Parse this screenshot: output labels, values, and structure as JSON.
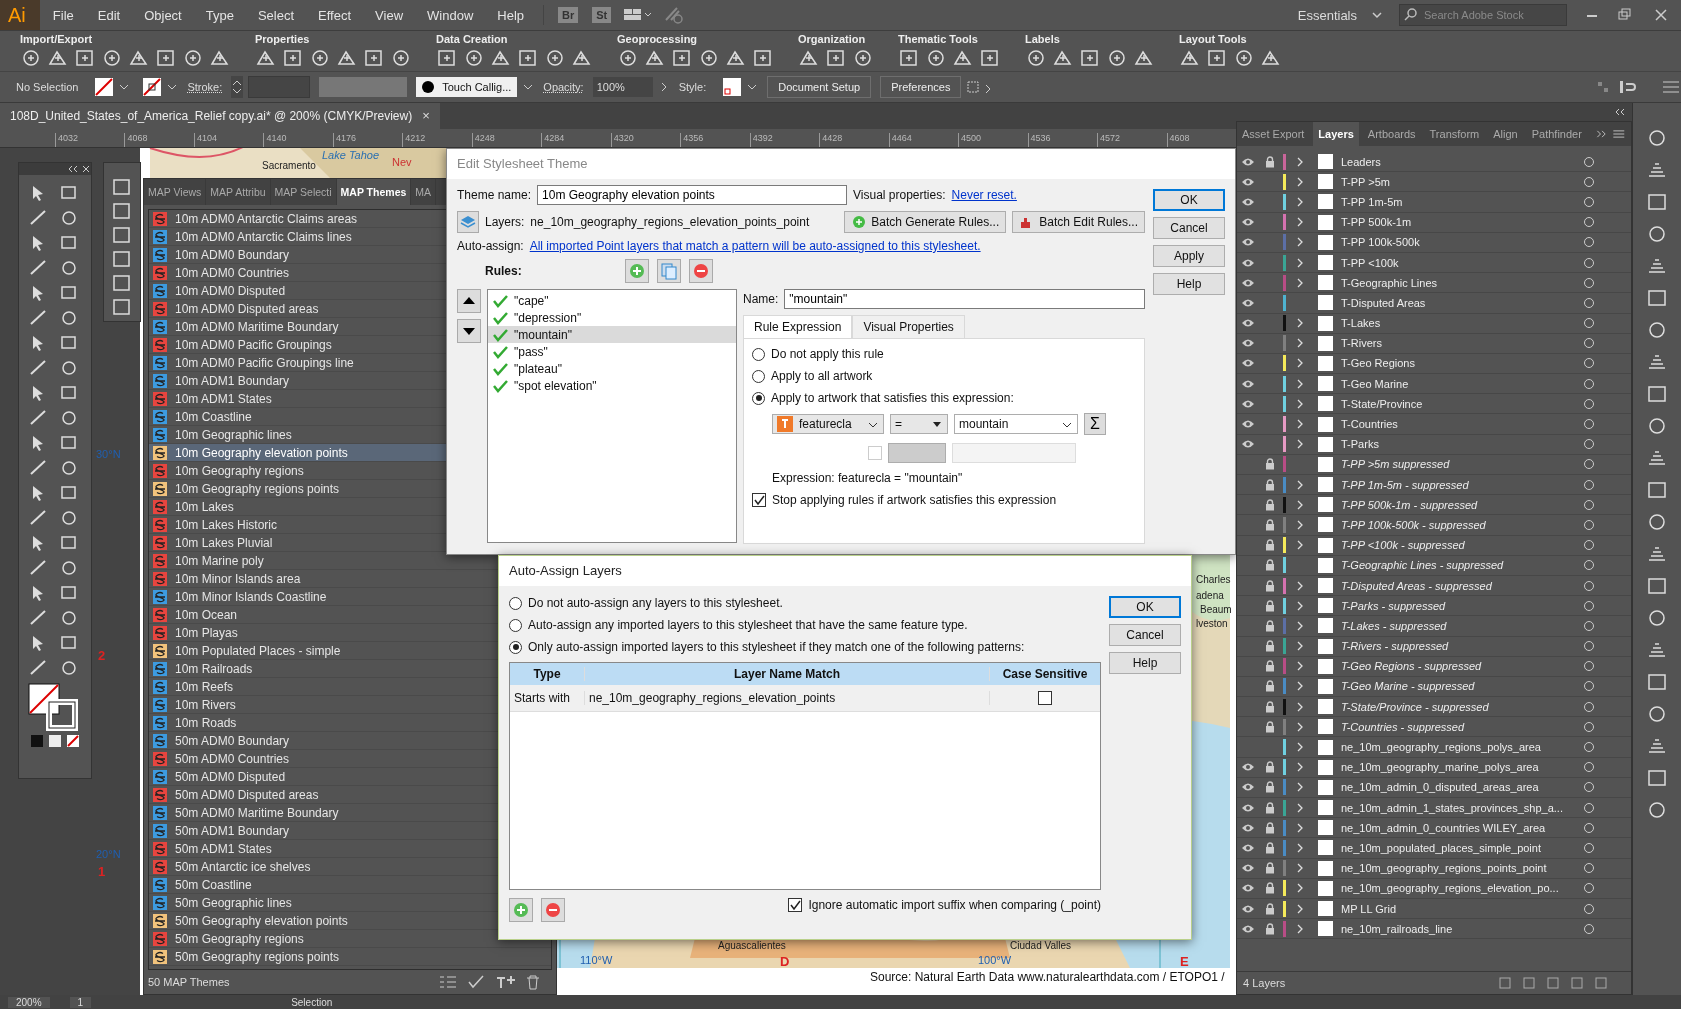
{
  "app": {
    "logo": "Ai",
    "menu": [
      "File",
      "Edit",
      "Object",
      "Type",
      "Select",
      "Effect",
      "View",
      "Window",
      "Help"
    ],
    "bridge": "Br",
    "stock": "St",
    "workspace": "Essentials",
    "search": {
      "placeholder": "Search Adobe Stock"
    }
  },
  "toolbar_groups": [
    {
      "label": "Import/Export"
    },
    {
      "label": "Properties"
    },
    {
      "label": "Data Creation"
    },
    {
      "label": "Geoprocessing"
    },
    {
      "label": "Organization"
    },
    {
      "label": "Thematic Tools"
    },
    {
      "label": "Labels"
    },
    {
      "label": "Layout Tools"
    }
  ],
  "control_bar": {
    "selection": "No Selection",
    "stroke_label": "Stroke:",
    "brush": "Touch Callig...",
    "opacity_label": "Opacity:",
    "opacity": "100%",
    "style_label": "Style:",
    "buttons": [
      "Document Setup",
      "Preferences"
    ]
  },
  "document_tab": {
    "title": "108D_United_States_of_America_Relief copy.ai* @ 200% (CMYK/Preview)",
    "close": "×"
  },
  "ruler": [
    "4032",
    "4068",
    "4104",
    "4140",
    "4176",
    "4212",
    "4248",
    "4284",
    "4320",
    "4356",
    "4392",
    "4428",
    "4464",
    "4500",
    "4536",
    "4572",
    "4608"
  ],
  "map_labels": [
    {
      "text": "Sacramento",
      "kind": "city"
    },
    {
      "text": "Lake Tahoe",
      "kind": "water"
    },
    {
      "text": "Nev",
      "kind": "state"
    },
    {
      "text": "30°N",
      "kind": "grid"
    },
    {
      "text": "2",
      "kind": "index"
    },
    {
      "text": "20°N",
      "kind": "grid"
    },
    {
      "text": "1",
      "kind": "index"
    },
    {
      "text": "Charles",
      "kind": "city"
    },
    {
      "text": "adena",
      "kind": "city"
    },
    {
      "text": "Beaum",
      "kind": "city"
    },
    {
      "text": "lveston",
      "kind": "city"
    },
    {
      "text": "Aguascalientes",
      "kind": "city"
    },
    {
      "text": "Ciudad Valles",
      "kind": "city"
    },
    {
      "text": "110°W",
      "kind": "grid"
    },
    {
      "text": "D",
      "kind": "index"
    },
    {
      "text": "100°W",
      "kind": "grid"
    },
    {
      "text": "E",
      "kind": "index"
    },
    {
      "text": "Source: Natural Earth Data www.naturalearthdata.com / ETOPO1 /",
      "kind": "credit"
    }
  ],
  "themes_panel": {
    "tabs": [
      {
        "label": "MAP Views",
        "selected": false
      },
      {
        "label": "MAP Attribu",
        "selected": false
      },
      {
        "label": "MAP Selecti",
        "selected": false
      },
      {
        "label": "MAP Themes",
        "selected": true
      },
      {
        "label": "MA",
        "selected": false
      }
    ],
    "items": [
      {
        "name": "10m ADM0 Antarctic Claims areas",
        "color": "#e8453f",
        "selected": false
      },
      {
        "name": "10m ADM0 Antarctic Claims lines",
        "color": "#3d9be0",
        "selected": false
      },
      {
        "name": "10m ADM0 Boundary",
        "color": "#3d9be0",
        "selected": false
      },
      {
        "name": "10m ADM0 Countries",
        "color": "#e8453f",
        "selected": false
      },
      {
        "name": "10m ADM0 Disputed",
        "color": "#3d9be0",
        "selected": false
      },
      {
        "name": "10m ADM0 Disputed areas",
        "color": "#e8453f",
        "selected": false
      },
      {
        "name": "10m ADM0 Maritime Boundary",
        "color": "#3d9be0",
        "selected": false
      },
      {
        "name": "10m ADM0 Pacific Groupings",
        "color": "#e8453f",
        "selected": false
      },
      {
        "name": "10m ADM0 Pacific Groupings line",
        "color": "#3d9be0",
        "selected": false
      },
      {
        "name": "10m ADM1 Boundary",
        "color": "#3d9be0",
        "selected": false
      },
      {
        "name": "10m ADM1 States",
        "color": "#e8453f",
        "selected": false
      },
      {
        "name": "10m Coastline",
        "color": "#3d9be0",
        "selected": false
      },
      {
        "name": "10m Geographic lines",
        "color": "#3d9be0",
        "selected": false
      },
      {
        "name": "10m Geography elevation points",
        "color": "#f2c37c",
        "selected": true
      },
      {
        "name": "10m Geography regions",
        "color": "#e8453f",
        "selected": false
      },
      {
        "name": "10m Geography regions points",
        "color": "#f2c37c",
        "selected": false
      },
      {
        "name": "10m Lakes",
        "color": "#e8453f",
        "selected": false
      },
      {
        "name": "10m Lakes Historic",
        "color": "#e8453f",
        "selected": false
      },
      {
        "name": "10m Lakes Pluvial",
        "color": "#e8453f",
        "selected": false
      },
      {
        "name": "10m Marine poly",
        "color": "#e8453f",
        "selected": false
      },
      {
        "name": "10m Minor Islands area",
        "color": "#e8453f",
        "selected": false
      },
      {
        "name": "10m Minor Islands Coastline",
        "color": "#3d9be0",
        "selected": false
      },
      {
        "name": "10m Ocean",
        "color": "#e8453f",
        "selected": false
      },
      {
        "name": "10m Playas",
        "color": "#e8453f",
        "selected": false
      },
      {
        "name": "10m Populated Places - simple",
        "color": "#f2c37c",
        "selected": false
      },
      {
        "name": "10m Railroads",
        "color": "#3d9be0",
        "selected": false
      },
      {
        "name": "10m Reefs",
        "color": "#3d9be0",
        "selected": false
      },
      {
        "name": "10m Rivers",
        "color": "#3d9be0",
        "selected": false
      },
      {
        "name": "10m Roads",
        "color": "#3d9be0",
        "selected": false
      },
      {
        "name": "50m ADM0 Boundary",
        "color": "#3d9be0",
        "selected": false
      },
      {
        "name": "50m ADM0 Countries",
        "color": "#e8453f",
        "selected": false
      },
      {
        "name": "50m ADM0 Disputed",
        "color": "#3d9be0",
        "selected": false
      },
      {
        "name": "50m ADM0 Disputed areas",
        "color": "#e8453f",
        "selected": false
      },
      {
        "name": "50m ADM0 Maritime Boundary",
        "color": "#3d9be0",
        "selected": false
      },
      {
        "name": "50m ADM1 Boundary",
        "color": "#3d9be0",
        "selected": false
      },
      {
        "name": "50m ADM1 States",
        "color": "#e8453f",
        "selected": false
      },
      {
        "name": "50m Antarctic ice shelves",
        "color": "#e8453f",
        "selected": false
      },
      {
        "name": "50m Coastline",
        "color": "#3d9be0",
        "selected": false
      },
      {
        "name": "50m Geographic lines",
        "color": "#3d9be0",
        "selected": false
      },
      {
        "name": "50m Geography elevation points",
        "color": "#f2c37c",
        "selected": false
      },
      {
        "name": "50m Geography regions",
        "color": "#e8453f",
        "selected": false
      },
      {
        "name": "50m Geography regions points",
        "color": "#f2c37c",
        "selected": false
      }
    ],
    "footer": "50 MAP Themes"
  },
  "stylesheet_dialog": {
    "title": "Edit Stylesheet Theme",
    "theme_name_label": "Theme name:",
    "theme_name": "10m Geography elevation points",
    "visual_label": "Visual properties:",
    "visual_link": "Never reset.",
    "layers_label": "Layers:",
    "layers_value": "ne_10m_geography_regions_elevation_points_point",
    "batch_buttons": [
      "Batch Generate Rules...",
      "Batch Edit Rules..."
    ],
    "auto_label": "Auto-assign:",
    "auto_link": "All imported Point layers that match a pattern will be auto-assigned to this stylesheet.",
    "rules_label": "Rules:",
    "rules": [
      {
        "name": "\"cape\"",
        "checked": true,
        "selected": false
      },
      {
        "name": "\"depression\"",
        "checked": true,
        "selected": false
      },
      {
        "name": "\"mountain\"",
        "checked": true,
        "selected": true
      },
      {
        "name": "\"pass\"",
        "checked": true,
        "selected": false
      },
      {
        "name": "\"plateau\"",
        "checked": true,
        "selected": false
      },
      {
        "name": "\"spot elevation\"",
        "checked": true,
        "selected": false
      }
    ],
    "name_label": "Name:",
    "name_value": "\"mountain\"",
    "tabs": [
      {
        "label": "Rule Expression",
        "selected": true
      },
      {
        "label": "Visual Properties",
        "selected": false
      }
    ],
    "options": [
      {
        "label": "Do not apply this rule",
        "selected": false
      },
      {
        "label": "Apply to all artwork",
        "selected": false
      },
      {
        "label": "Apply to artwork that satisfies this expression:",
        "selected": true
      }
    ],
    "field": "featurecla",
    "operator": "=",
    "value": "mountain",
    "sigma": "Σ",
    "second_row_checked": false,
    "expression": "Expression: featurecla = \"mountain\"",
    "stop_option": {
      "label": "Stop applying rules if artwork satisfies this expression",
      "checked": true
    },
    "buttons": [
      "OK",
      "Cancel",
      "Apply",
      "Help"
    ]
  },
  "auto_assign_dialog": {
    "title": "Auto-Assign Layers",
    "options": [
      {
        "label": "Do not auto-assign any layers to this stylesheet.",
        "selected": false
      },
      {
        "label": "Auto-assign any imported layers to this stylesheet that have the same feature type.",
        "selected": false
      },
      {
        "label": "Only auto-assign imported layers to this stylesheet if they match one of the following patterns:",
        "selected": true
      }
    ],
    "columns": [
      "Type",
      "Layer Name Match",
      "Case Sensitive"
    ],
    "rows": [
      {
        "type": "Starts with",
        "match": "ne_10m_geography_regions_elevation_points",
        "case_sensitive": false
      }
    ],
    "ignore_option": {
      "label": "Ignore automatic import suffix when comparing (_point)",
      "checked": true
    },
    "buttons": [
      "OK",
      "Cancel",
      "Help"
    ]
  },
  "layers_panel": {
    "tabs": [
      {
        "label": "Asset Export",
        "selected": false
      },
      {
        "label": "Layers",
        "selected": true
      },
      {
        "label": "Artboards",
        "selected": false
      },
      {
        "label": "Transform",
        "selected": false
      },
      {
        "label": "Align",
        "selected": false
      },
      {
        "label": "Pathfinder",
        "selected": false
      }
    ],
    "layers": [
      {
        "name": "Leaders",
        "visible": true,
        "locked": true,
        "color": "#c9659a",
        "expandable": true,
        "kind": "regular"
      },
      {
        "name": "T-PP >5m",
        "visible": true,
        "locked": false,
        "color": "#f5ea5a",
        "expandable": true,
        "kind": "regular"
      },
      {
        "name": "T-PP 1m-5m",
        "visible": true,
        "locked": false,
        "color": "#6fd0e0",
        "expandable": true,
        "kind": "regular"
      },
      {
        "name": "T-PP 500k-1m",
        "visible": true,
        "locked": false,
        "color": "#d572b0",
        "expandable": true,
        "kind": "regular"
      },
      {
        "name": "T-PP 100k-500k",
        "visible": true,
        "locked": false,
        "color": "#5c6fa6",
        "expandable": true,
        "kind": "regular"
      },
      {
        "name": "T-PP <100k",
        "visible": true,
        "locked": false,
        "color": "#3aa595",
        "expandable": true,
        "kind": "regular"
      },
      {
        "name": "T-Geographic Lines",
        "visible": true,
        "locked": false,
        "color": "#b84d86",
        "expandable": true,
        "kind": "regular"
      },
      {
        "name": "T-Disputed Areas",
        "visible": true,
        "locked": false,
        "color": "#4fb3d0",
        "expandable": false,
        "kind": "regular"
      },
      {
        "name": "T-Lakes",
        "visible": true,
        "locked": false,
        "color": "#111111",
        "expandable": true,
        "kind": "regular"
      },
      {
        "name": "T-Rivers",
        "visible": true,
        "locked": false,
        "color": "#808080",
        "expandable": true,
        "kind": "regular"
      },
      {
        "name": "T-Geo Regions",
        "visible": true,
        "locked": false,
        "color": "#f5ea5a",
        "expandable": true,
        "kind": "regular"
      },
      {
        "name": "T-Geo Marine",
        "visible": true,
        "locked": false,
        "color": "#6fd0e0",
        "expandable": true,
        "kind": "regular"
      },
      {
        "name": "T-State/Province",
        "visible": true,
        "locked": false,
        "color": "#6fd0e0",
        "expandable": true,
        "kind": "regular"
      },
      {
        "name": "T-Countries",
        "visible": true,
        "locked": false,
        "color": "#e79ac4",
        "expandable": true,
        "kind": "regular"
      },
      {
        "name": "T-Parks",
        "visible": true,
        "locked": false,
        "color": "#e79ac4",
        "expandable": true,
        "kind": "regular"
      },
      {
        "name": "T-PP >5m suppressed",
        "visible": false,
        "locked": true,
        "color": "#b84d86",
        "expandable": false,
        "kind": "suppressed"
      },
      {
        "name": "T-PP 1m-5m - suppressed",
        "visible": false,
        "locked": true,
        "color": "#4a8cc4",
        "expandable": true,
        "kind": "suppressed"
      },
      {
        "name": "T-PP 500k-1m - suppressed",
        "visible": false,
        "locked": true,
        "color": "#111111",
        "expandable": true,
        "kind": "suppressed"
      },
      {
        "name": "T-PP 100k-500k - suppressed",
        "visible": false,
        "locked": true,
        "color": "#808080",
        "expandable": true,
        "kind": "suppressed"
      },
      {
        "name": "T-PP <100k - suppressed",
        "visible": false,
        "locked": true,
        "color": "#f5ea5a",
        "expandable": true,
        "kind": "suppressed"
      },
      {
        "name": "T-Geographic Lines - suppressed",
        "visible": false,
        "locked": true,
        "color": "#6fd0e0",
        "expandable": false,
        "kind": "suppressed"
      },
      {
        "name": "T-Disputed Areas - suppressed",
        "visible": false,
        "locked": true,
        "color": "#d572b0",
        "expandable": true,
        "kind": "suppressed"
      },
      {
        "name": "T-Parks - suppressed",
        "visible": false,
        "locked": true,
        "color": "#6fd0e0",
        "expandable": true,
        "kind": "suppressed"
      },
      {
        "name": "T-Lakes - suppressed",
        "visible": false,
        "locked": true,
        "color": "#5c6fa6",
        "expandable": true,
        "kind": "suppressed"
      },
      {
        "name": "T-Rivers - suppressed",
        "visible": false,
        "locked": true,
        "color": "#3aa595",
        "expandable": true,
        "kind": "suppressed"
      },
      {
        "name": "T-Geo Regions - suppressed",
        "visible": false,
        "locked": true,
        "color": "#b84d86",
        "expandable": true,
        "kind": "suppressed"
      },
      {
        "name": "T-Geo Marine - suppressed",
        "visible": false,
        "locked": true,
        "color": "#4a8cc4",
        "expandable": true,
        "kind": "suppressed"
      },
      {
        "name": "T-State/Province - suppressed",
        "visible": false,
        "locked": true,
        "color": "#111111",
        "expandable": true,
        "kind": "suppressed"
      },
      {
        "name": "T-Countries - suppressed",
        "visible": false,
        "locked": true,
        "color": "#808080",
        "expandable": true,
        "kind": "suppressed"
      },
      {
        "name": "ne_10m_geography_regions_polys_area",
        "visible": false,
        "locked": false,
        "color": "#6fd0e0",
        "expandable": true,
        "kind": "regular"
      },
      {
        "name": "ne_10m_geography_marine_polys_area",
        "visible": true,
        "locked": true,
        "color": "#6fd0e0",
        "expandable": true,
        "kind": "regular"
      },
      {
        "name": "ne_10m_admin_0_disputed_areas_area",
        "visible": true,
        "locked": true,
        "color": "#4a8cc4",
        "expandable": true,
        "kind": "regular"
      },
      {
        "name": "ne_10m_admin_1_states_provinces_shp_a...",
        "visible": true,
        "locked": true,
        "color": "#3aa595",
        "expandable": true,
        "kind": "regular"
      },
      {
        "name": "ne_10m_admin_0_countries WILEY_area",
        "visible": true,
        "locked": true,
        "color": "#4a8cc4",
        "expandable": true,
        "kind": "regular"
      },
      {
        "name": "ne_10m_populated_places_simple_point",
        "visible": true,
        "locked": true,
        "color": "#4a8cc4",
        "expandable": true,
        "kind": "regular"
      },
      {
        "name": "ne_10m_geography_regions_points_point",
        "visible": true,
        "locked": true,
        "color": "#808080",
        "expandable": true,
        "kind": "regular"
      },
      {
        "name": "ne_10m_geography_regions_elevation_po...",
        "visible": true,
        "locked": true,
        "color": "#f5ea5a",
        "expandable": true,
        "kind": "regular"
      },
      {
        "name": "MP LL Grid",
        "visible": true,
        "locked": true,
        "color": "#f5ea5a",
        "expandable": true,
        "kind": "regular"
      },
      {
        "name": "ne_10m_railroads_line",
        "visible": true,
        "locked": true,
        "color": "#b84d86",
        "expandable": true,
        "kind": "regular"
      }
    ],
    "footer": "4 Layers"
  },
  "status_bar": {
    "zoom": "200%",
    "artboard": "1",
    "tool": "Selection"
  }
}
